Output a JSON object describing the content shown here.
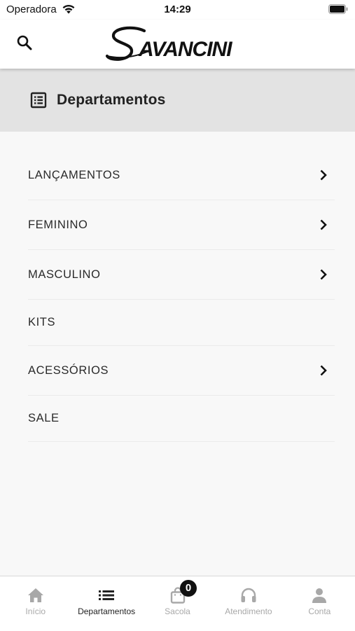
{
  "status_bar": {
    "carrier": "Operadora",
    "time": "14:29"
  },
  "header": {
    "logo_text": "SAVANCINI",
    "search_icon": "search-icon"
  },
  "section": {
    "title": "Departamentos",
    "icon": "list-alt-icon"
  },
  "departments": [
    {
      "label": "LANÇAMENTOS",
      "has_children": true
    },
    {
      "label": "FEMININO",
      "has_children": true
    },
    {
      "label": "MASCULINO",
      "has_children": true
    },
    {
      "label": "KITS",
      "has_children": false
    },
    {
      "label": "ACESSÓRIOS",
      "has_children": true
    },
    {
      "label": "SALE",
      "has_children": false
    }
  ],
  "tabs": [
    {
      "label": "Início",
      "icon": "home-icon",
      "active": false
    },
    {
      "label": "Departamentos",
      "icon": "list-icon",
      "active": true
    },
    {
      "label": "Sacola",
      "icon": "bag-icon",
      "active": false
    },
    {
      "label": "Atendimento",
      "icon": "headset-icon",
      "active": false
    },
    {
      "label": "Conta",
      "icon": "person-icon",
      "active": false
    }
  ],
  "cart_badge": "0",
  "colors": {
    "section_bg": "#e3e3e3",
    "inactive_tab": "#a8a8a8",
    "active_tab": "#222222",
    "badge_bg": "#111111"
  }
}
